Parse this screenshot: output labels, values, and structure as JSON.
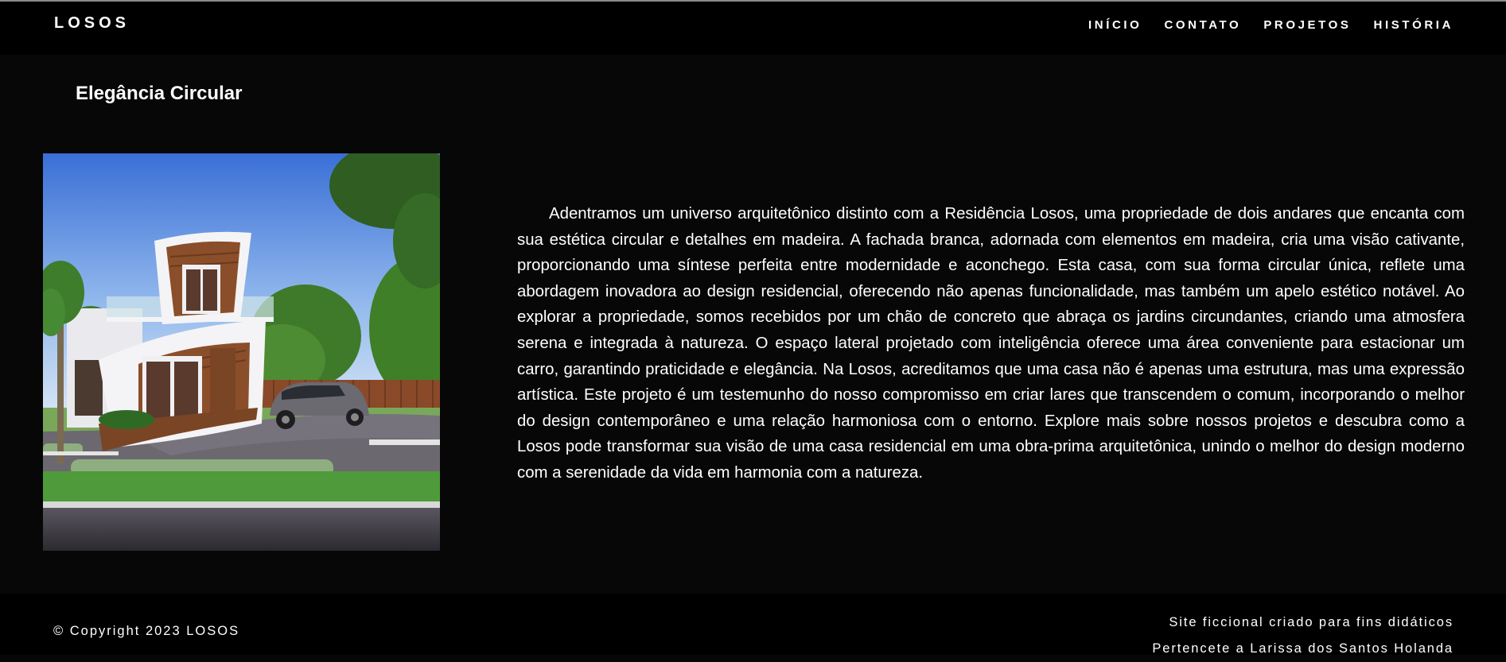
{
  "header": {
    "logo": "LOSOS",
    "nav": [
      {
        "label": "INÍCIO"
      },
      {
        "label": "CONTATO"
      },
      {
        "label": "PROJETOS"
      },
      {
        "label": "HISTÓRIA"
      }
    ]
  },
  "main": {
    "title": "Elegância Circular",
    "image_icon": "house-photo",
    "paragraph": "Adentramos um universo arquitetônico distinto com a Residência Losos, uma propriedade de dois andares que encanta com sua estética circular e detalhes em madeira. A fachada branca, adornada com elementos em madeira, cria uma visão cativante, proporcionando uma síntese perfeita entre modernidade e aconchego. Esta casa, com sua forma circular única, reflete uma abordagem inovadora ao design residencial, oferecendo não apenas funcionalidade, mas também um apelo estético notável. Ao explorar a propriedade, somos recebidos por um chão de concreto que abraça os jardins circundantes, criando uma atmosfera serena e integrada à natureza. O espaço lateral projetado com inteligência oferece uma área conveniente para estacionar um carro, garantindo praticidade e elegância. Na Losos, acreditamos que uma casa não é apenas uma estrutura, mas uma expressão artística. Este projeto é um testemunho do nosso compromisso em criar lares que transcendem o comum, incorporando o melhor do design contemporâneo e uma relação harmoniosa com o entorno. Explore mais sobre nossos projetos e descubra como a Losos pode transformar sua visão de uma casa residencial em uma obra-prima arquitetônica, unindo o melhor do design moderno com a serenidade da vida em harmonia com a natureza."
  },
  "footer": {
    "copyright": "© Copyright 2023 LOSOS",
    "note_line1": "Site ficcional criado para fins didáticos",
    "note_line2": "Pertencete a Larissa dos Santos Holanda"
  },
  "colors": {
    "header_bg": "#000000",
    "page_bg": "#070707",
    "text": "#ffffff"
  }
}
